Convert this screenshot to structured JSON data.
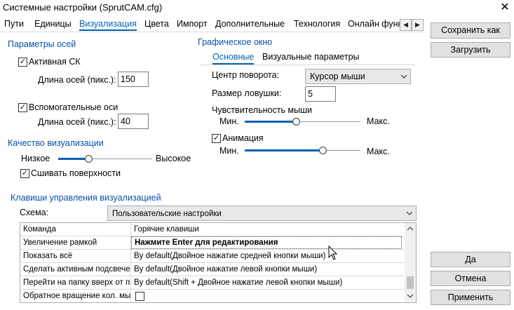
{
  "window": {
    "title": "Системные настройки (SprutCAM.cfg)"
  },
  "tabs": [
    "Пути",
    "Единицы",
    "Визуализация",
    "Цвета",
    "Импорт",
    "Дополнительные",
    "Технология",
    "Онлайн функ"
  ],
  "axes_params": {
    "title": "Параметры осей",
    "active_cs_label": "Активная СК",
    "axis_len_label": "Длина осей (пикс.):",
    "axis_len_value": "150",
    "aux_axes_label": "Вспомогательные оси",
    "aux_len_label": "Длина осей (пикс.):",
    "aux_len_value": "40"
  },
  "viz_quality": {
    "title": "Качество визуализации",
    "low_label": "Низкое",
    "high_label": "Высокое",
    "level": 0.32,
    "stitch_label": "Сшивать поверхности"
  },
  "graphics_window": {
    "title": "Графическое окно",
    "tab_main": "Основные",
    "tab_visual": "Визуальные параметры",
    "rotation_center_label": "Центр поворота:",
    "rotation_center_value": "Курсор мыши",
    "trap_size_label": "Размер ловушки:",
    "trap_size_value": "5",
    "mouse_sens_label": "Чувствительность мыши",
    "min_label": "Мин.",
    "max_label": "Макс.",
    "mouse_sens_level": 0.44,
    "animation_label": "Анимация",
    "anim_min_label": "Мин.",
    "anim_max_label": "Макс.",
    "anim_level": 0.67
  },
  "shortcuts": {
    "title": "Клавиши управления визуализацией",
    "scheme_label": "Схема:",
    "scheme_value": "Пользовательские настройки",
    "header": {
      "command": "Команда",
      "hotkeys": "Горячие клавиши"
    },
    "rows": [
      {
        "command": "Увеличение рамкой",
        "hotkeys": "Нажмите Enter для редактирования"
      },
      {
        "command": "Показать всё",
        "hotkeys": "By default(Двойное нажатие средней кнопки мыши)"
      },
      {
        "command": "Сделать активным подсвечен",
        "hotkeys": "By default(Двойное нажатие левой кнопки мыши)"
      },
      {
        "command": "Перейти на папку вверх от по",
        "hotkeys": "By default(Shift + Двойное нажатие левой кнопки мыши)"
      },
      {
        "command": "Обратное вращение кол. мыш",
        "hotkeys": ""
      }
    ]
  },
  "buttons": {
    "save_as": "Сохранить как",
    "load": "Загрузить",
    "ok": "Да",
    "cancel": "Отмена",
    "apply": "Применить"
  },
  "colors": {
    "accent": "#0063b1",
    "group_header": "#0a4ea8"
  },
  "icons": {
    "close": "close-icon",
    "check": "check-icon",
    "chevron": "chevron-down-icon"
  }
}
